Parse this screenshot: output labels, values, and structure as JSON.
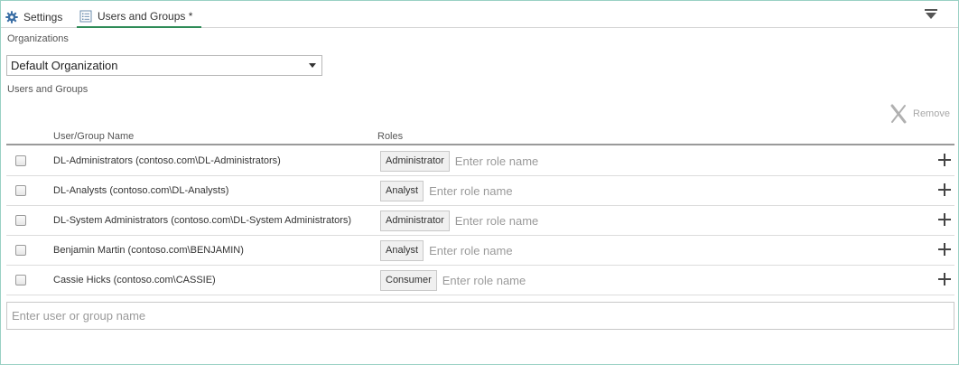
{
  "tabs": [
    {
      "label": "Settings",
      "icon": "gear-icon"
    },
    {
      "label": "Users and Groups *",
      "icon": "list-icon",
      "active": true
    }
  ],
  "organizations": {
    "label": "Organizations",
    "selected": "Default Organization"
  },
  "users_groups": {
    "label": "Users and Groups",
    "remove_label": "Remove",
    "columns": {
      "name": "User/Group Name",
      "roles": "Roles"
    },
    "rows": [
      {
        "name": "DL-Administrators (contoso.com\\DL-Administrators)",
        "role": "Administrator",
        "role_placeholder": "Enter role name"
      },
      {
        "name": "DL-Analysts (contoso.com\\DL-Analysts)",
        "role": "Analyst",
        "role_placeholder": "Enter role name"
      },
      {
        "name": "DL-System Administrators (contoso.com\\DL-System Administrators)",
        "role": "Administrator",
        "role_placeholder": "Enter role name"
      },
      {
        "name": "Benjamin Martin (contoso.com\\BENJAMIN)",
        "role": "Analyst",
        "role_placeholder": "Enter role name"
      },
      {
        "name": "Cassie Hicks (contoso.com\\CASSIE)",
        "role": "Consumer",
        "role_placeholder": "Enter role name"
      }
    ],
    "add_placeholder": "Enter user or group name"
  },
  "colors": {
    "accent": "#2e8b57",
    "gear": "#3a6ea5",
    "border": "#9ad1c4"
  }
}
